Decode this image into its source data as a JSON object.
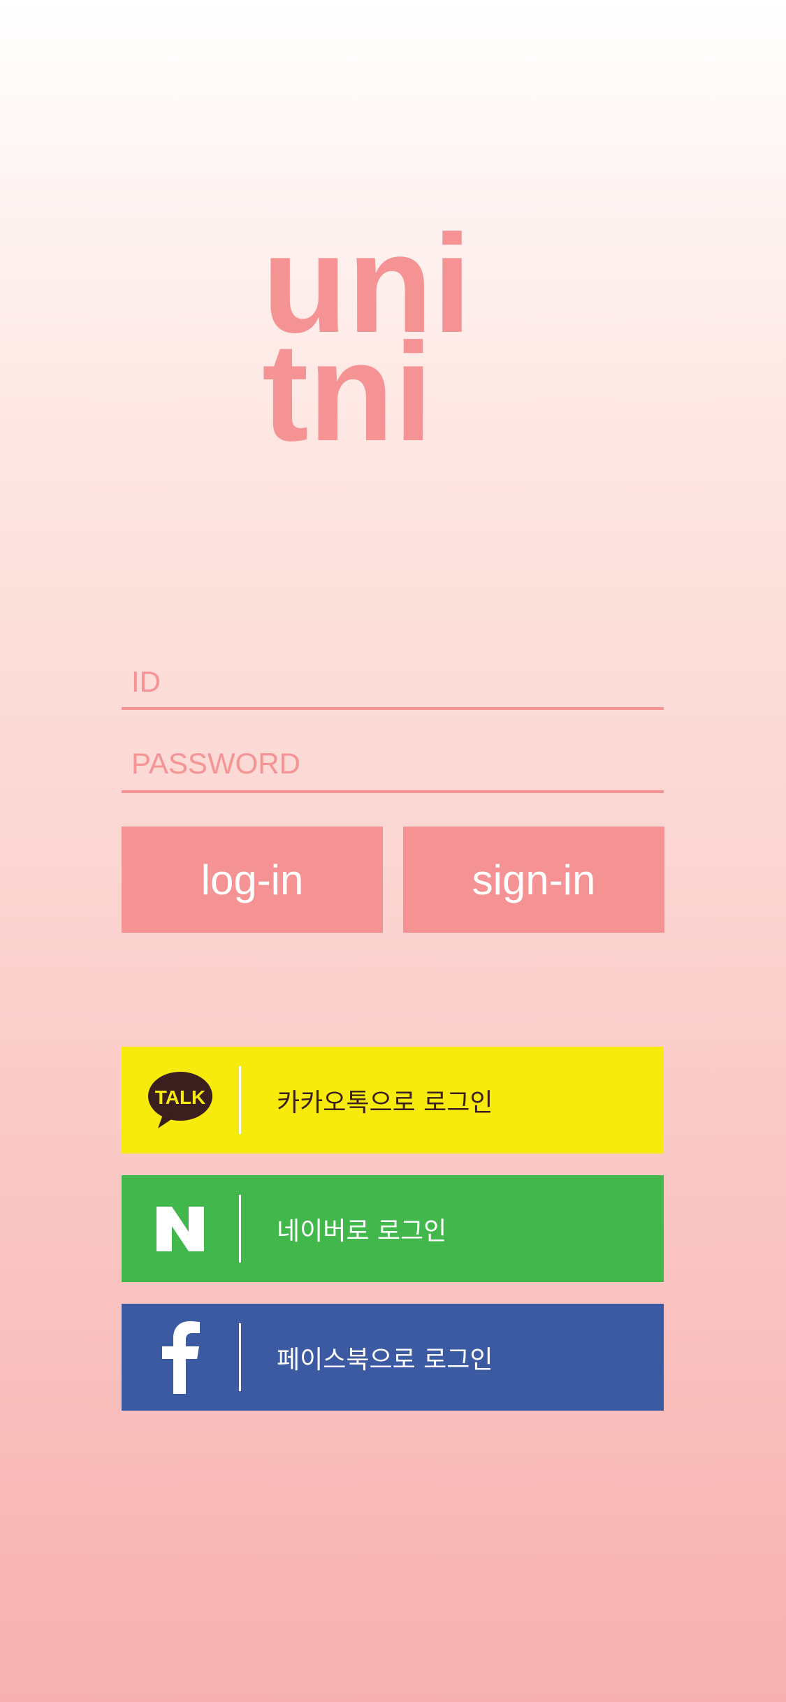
{
  "logo": {
    "text_line1": "uni",
    "text_line2": "tni",
    "color": "#f49294"
  },
  "form": {
    "id_placeholder": "ID",
    "password_placeholder": "PASSWORD",
    "accent_color": "#f49494"
  },
  "buttons": {
    "login_label": "log-in",
    "signin_label": "sign-in"
  },
  "social": [
    {
      "id": "kakao",
      "icon": "kakao-talk-icon",
      "icon_text": "TALK",
      "label": "카카오톡으로 로그인",
      "color": "#f7eb0e"
    },
    {
      "id": "naver",
      "icon": "naver-icon",
      "icon_text": "N",
      "label": "네이버로 로그인",
      "color": "#42b84c"
    },
    {
      "id": "facebook",
      "icon": "facebook-icon",
      "icon_text": "f",
      "label": "페이스북으로 로그인",
      "color": "#3b5aa2"
    }
  ]
}
